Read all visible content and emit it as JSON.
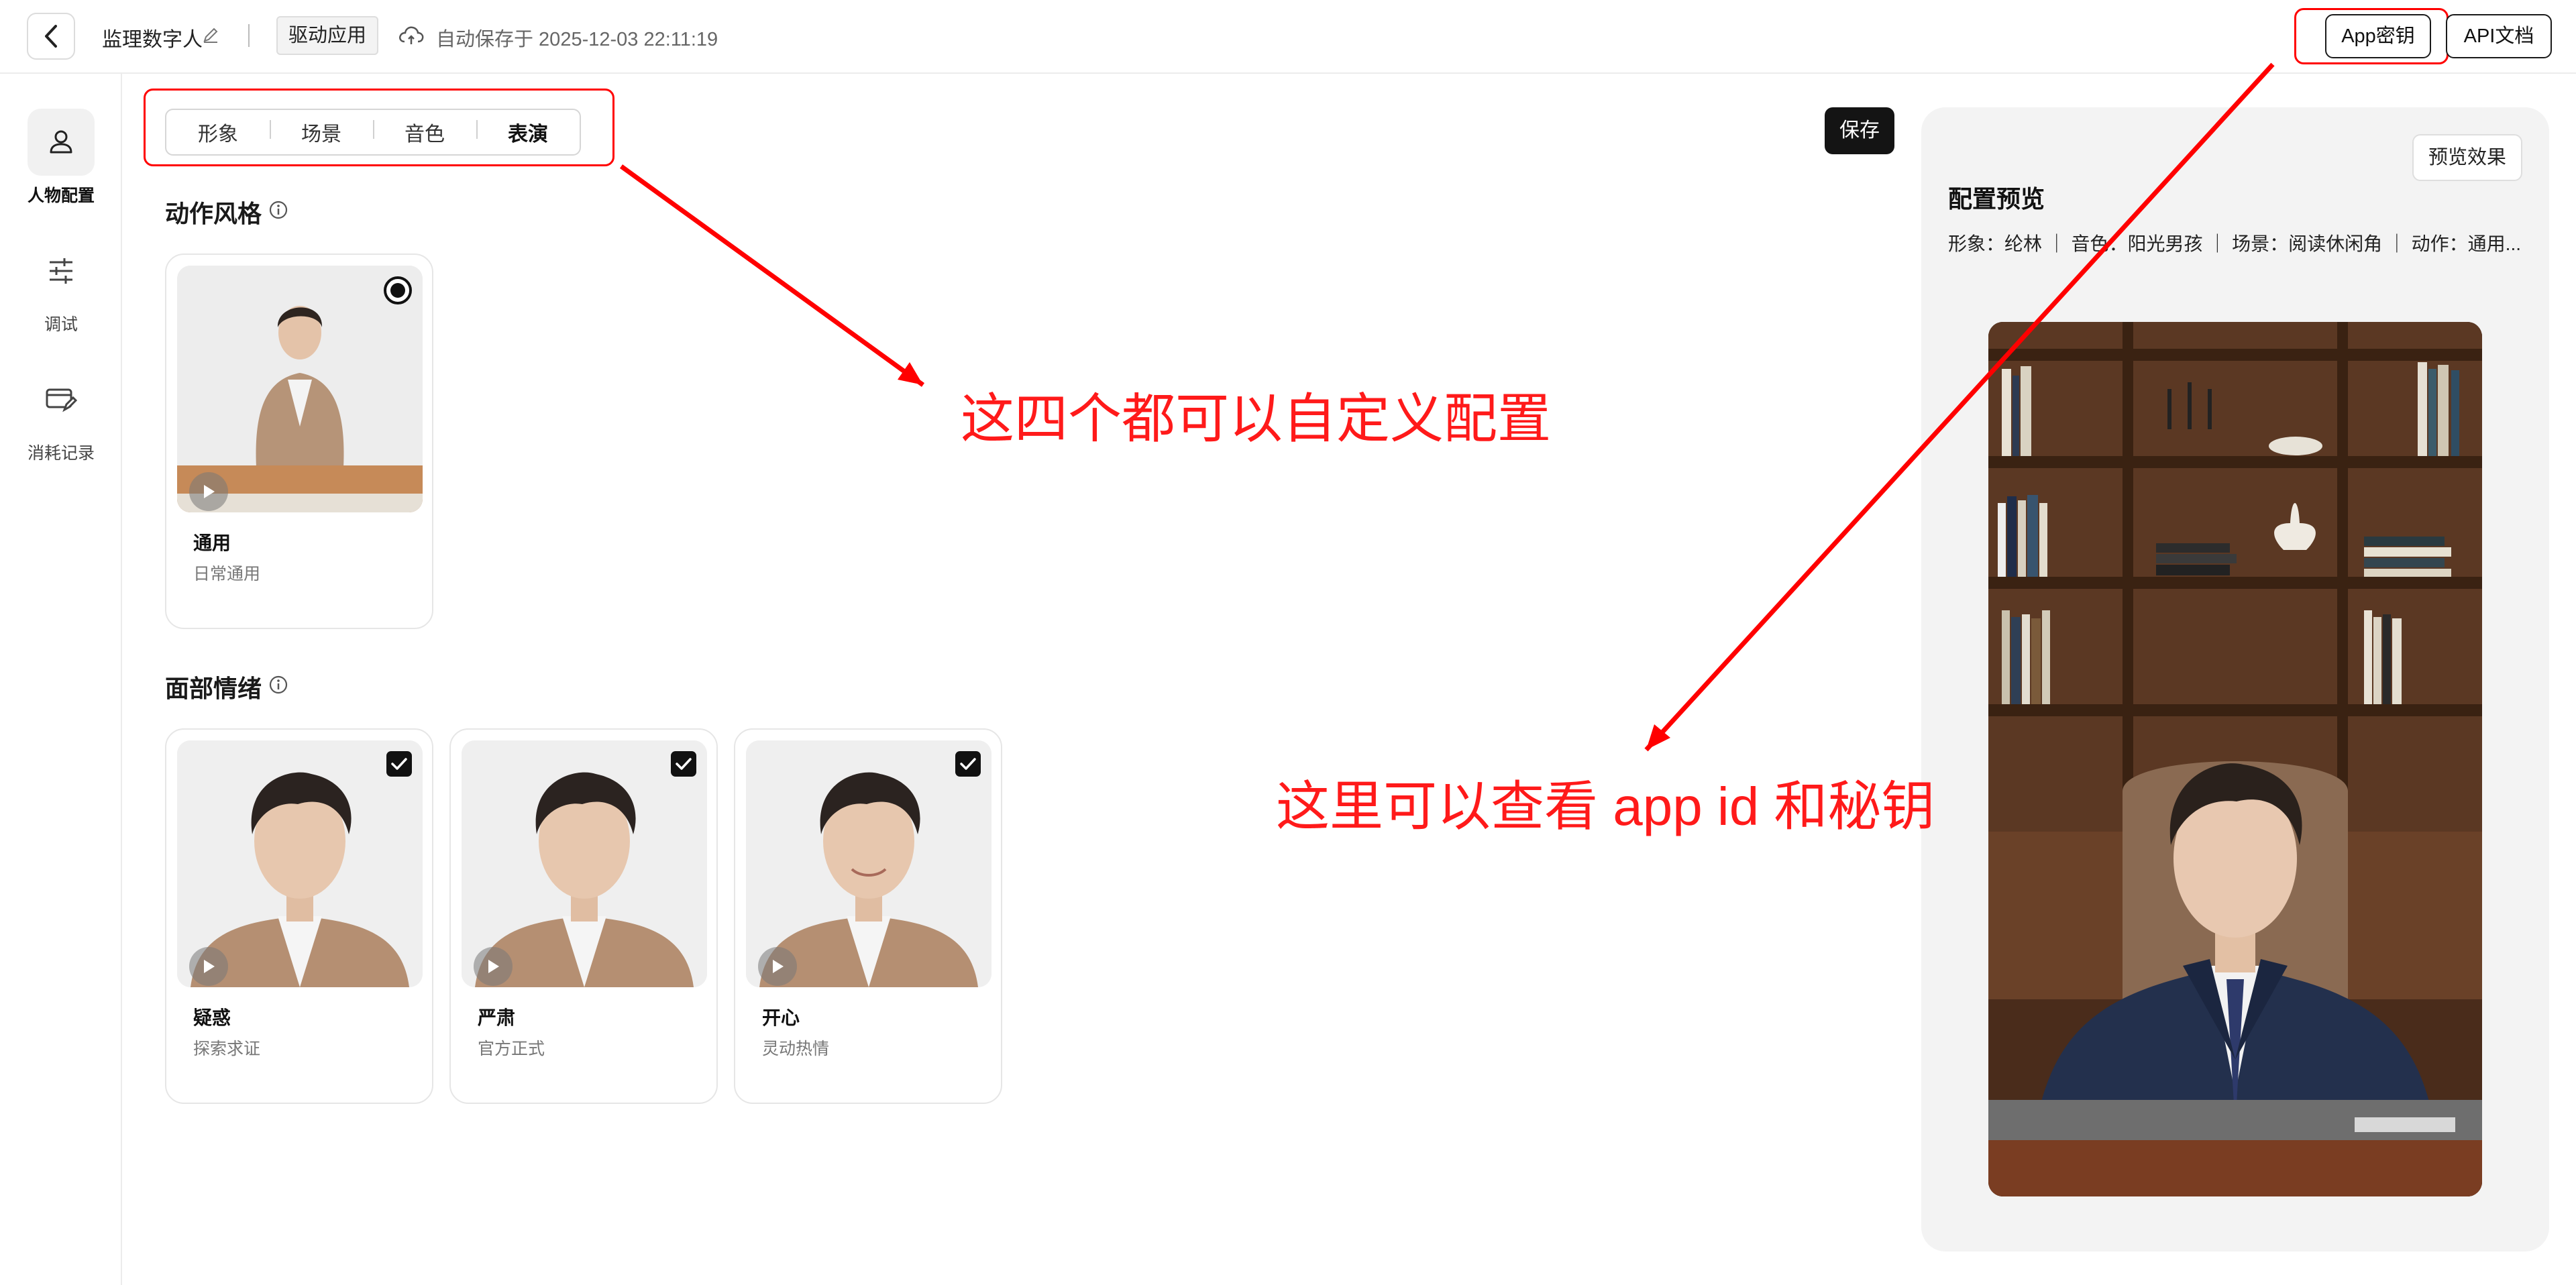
{
  "header": {
    "app_name": "监理数字人",
    "app_type_tag": "驱动应用",
    "autosave_text": "自动保存于 2025-12-03 22:11:19",
    "app_key_button": "App密钥",
    "api_doc_button": "API文档"
  },
  "sidebar": {
    "items": [
      {
        "label": "人物配置",
        "icon": "person-icon",
        "active": true
      },
      {
        "label": "调试",
        "icon": "sliders-icon",
        "active": false
      },
      {
        "label": "消耗记录",
        "icon": "card-edit-icon",
        "active": false
      }
    ]
  },
  "tabs": {
    "items": [
      {
        "label": "形象"
      },
      {
        "label": "场景"
      },
      {
        "label": "音色"
      },
      {
        "label": "表演"
      }
    ],
    "active": "表演"
  },
  "save_button": "保存",
  "action_style": {
    "title": "动作风格",
    "cards": [
      {
        "name": "通用",
        "desc": "日常通用",
        "selected": true
      }
    ]
  },
  "facial_emotion": {
    "title": "面部情绪",
    "cards": [
      {
        "name": "疑惑",
        "desc": "探索求证",
        "checked": true
      },
      {
        "name": "严肃",
        "desc": "官方正式",
        "checked": true
      },
      {
        "name": "开心",
        "desc": "灵动热情",
        "checked": true
      }
    ]
  },
  "annotations": {
    "tabs_note": "这四个都可以自定义配置",
    "appkey_note": "这里可以查看 app id 和秘钥",
    "color": "#ff1a1a"
  },
  "preview": {
    "effect_button": "预览效果",
    "title": "配置预览",
    "summary": "形象：纶林 ｜ 音色：阳光男孩 ｜ 场景：阅读休闲角 ｜ 动作：通用..."
  },
  "colors": {
    "primary_dark": "#141414",
    "annotation_red": "#ff0000",
    "panel_bg": "#f3f3f3"
  }
}
